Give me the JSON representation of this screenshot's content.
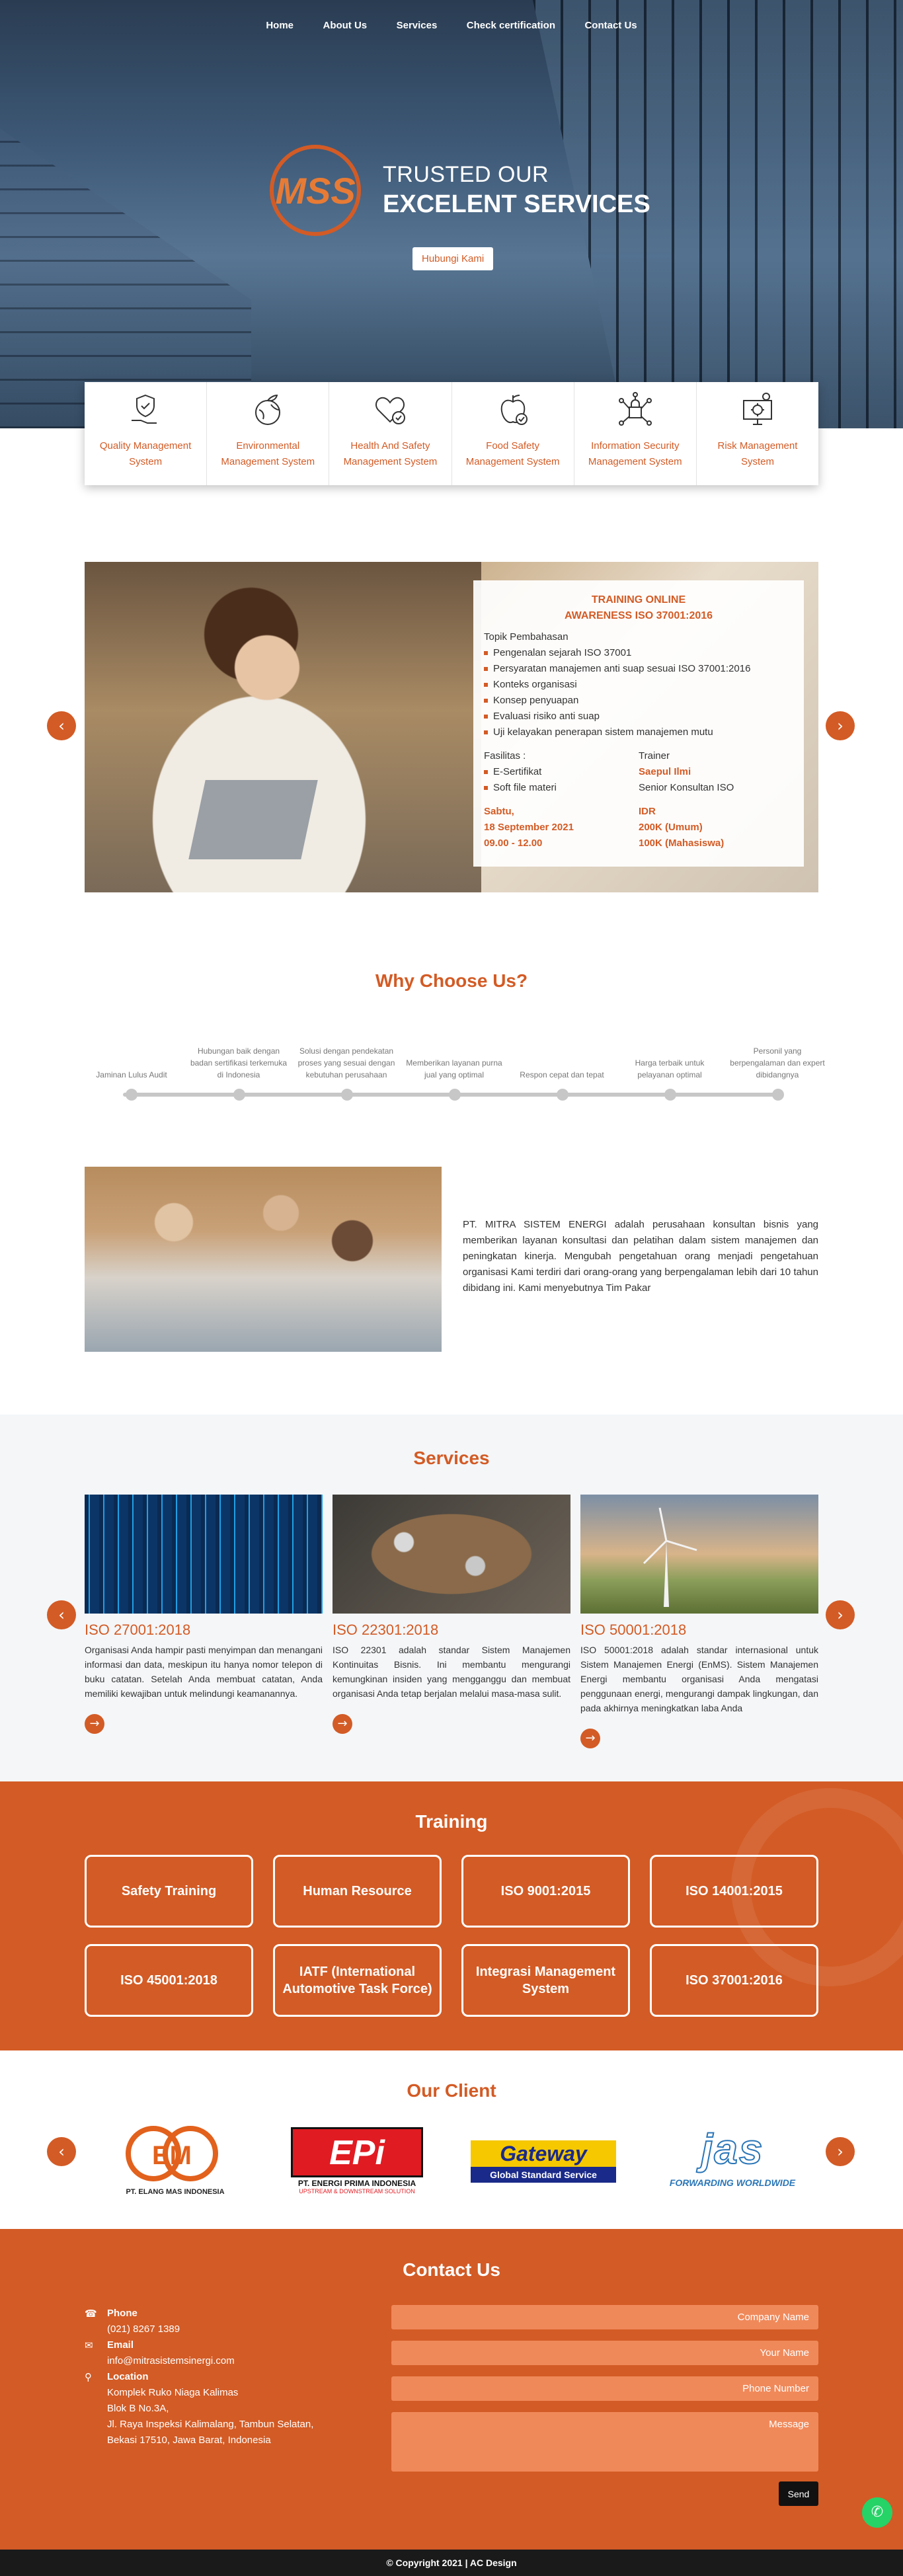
{
  "nav": {
    "home": "Home",
    "about": "About Us",
    "services": "Services",
    "check": "Check certification",
    "contact": "Contact Us"
  },
  "hero": {
    "logo_text": "MSS",
    "line1": "TRUSTED OUR",
    "line2": "EXCELENT SERVICES",
    "button": "Hubungi Kami"
  },
  "systems": [
    {
      "label": "Quality Management System",
      "icon": "hand-shield-icon"
    },
    {
      "label": "Environmental Management System",
      "icon": "globe-leaf-icon"
    },
    {
      "label": "Health And Safety Management System",
      "icon": "heart-check-icon"
    },
    {
      "label": "Food Safety Management System",
      "icon": "apple-check-icon"
    },
    {
      "label": "Information Security Management System",
      "icon": "lock-network-icon"
    },
    {
      "label": "Risk Management System",
      "icon": "gear-monitor-icon"
    }
  ],
  "training_banner": {
    "title1": "TRAINING ONLINE",
    "title2": "AWARENESS ISO 37001:2016",
    "topics_label": "Topik Pembahasan",
    "topics": [
      "Pengenalan sejarah ISO 37001",
      "Persyaratan manajemen anti suap sesuai ISO 37001:2016",
      "Konteks organisasi",
      "Konsep penyuapan",
      "Evaluasi risiko anti suap",
      "Uji kelayakan penerapan sistem manajemen mutu"
    ],
    "facilities_label": "Fasilitas :",
    "facilities": [
      "E-Sertifikat",
      "Soft file materi"
    ],
    "trainer_label": "Trainer",
    "trainer_name": "Saepul Ilmi",
    "trainer_role": "Senior Konsultan ISO",
    "day": "Sabtu,",
    "date": "18 September 2021",
    "time": "09.00 - 12.00",
    "currency": "IDR",
    "price_general": "200K (Umum)",
    "price_student": "100K (Mahasiswa)"
  },
  "why": {
    "title": "Why Choose Us?",
    "items": [
      "Jaminan Lulus Audit",
      "Hubungan baik dengan badan sertifikasi terkemuka di Indonesia",
      "Solusi dengan pendekatan proses yang sesuai dengan kebutuhan perusahaan",
      "Memberikan layanan purna jual yang optimal",
      "Respon cepat dan tepat",
      "Harga terbaik untuk pelayanan optimal",
      "Personil yang berpengalaman dan expert dibidangnya"
    ]
  },
  "about": {
    "text": "PT. MITRA SISTEM ENERGI adalah perusahaan konsultan bisnis yang memberikan layanan konsultasi dan pelatihan dalam sistem manajemen dan peningkatan kinerja. Mengubah pengetahuan orang menjadi pengetahuan organisasi Kami terdiri dari orang-orang yang berpengalaman lebih dari 10 tahun dibidang ini. Kami menyebutnya Tim Pakar"
  },
  "services": {
    "title": "Services",
    "items": [
      {
        "title": "ISO 27001:2018",
        "text": "Organisasi Anda hampir pasti menyimpan dan menangani informasi dan data, meskipun itu hanya nomor telepon di buku catatan. Setelah Anda membuat catatan, Anda memiliki kewajiban untuk melindungi keamanannya."
      },
      {
        "title": "ISO 22301:2018",
        "text": "ISO 22301 adalah standar Sistem Manajemen Kontinuitas Bisnis. Ini membantu mengurangi kemungkinan insiden yang mengganggu dan membuat organisasi Anda tetap berjalan melalui masa-masa sulit."
      },
      {
        "title": "ISO 50001:2018",
        "text": "ISO 50001:2018 adalah standar internasional untuk Sistem Manajemen Energi (EnMS). Sistem Manajemen Energi membantu organisasi Anda mengatasi penggunaan energi, mengurangi dampak lingkungan, dan pada akhirnya meningkatkan laba Anda"
      }
    ]
  },
  "training": {
    "title": "Training",
    "items": [
      "Safety Training",
      "Human Resource",
      "ISO 9001:2015",
      "ISO 14001:2015",
      "ISO 45001:2018",
      "IATF (International Automotive Task Force)",
      "Integrasi Management System",
      "ISO 37001:2016"
    ]
  },
  "clients": {
    "title": "Our Client",
    "items": [
      {
        "logo": "EM",
        "name": "PT. ELANG MAS INDONESIA"
      },
      {
        "logo": "EPi",
        "name": "PT. ENERGI PRIMA INDONESIA",
        "sub": "UPSTREAM & DOWNSTREAM SOLUTION"
      },
      {
        "logo": "Gateway",
        "name": "Global Standard Service"
      },
      {
        "logo": "jas",
        "name": "FORWARDING WORLDWIDE"
      }
    ]
  },
  "contact": {
    "title": "Contact Us",
    "phone_label": "Phone",
    "phone": "(021) 8267 1389",
    "email_label": "Email",
    "email": "info@mitrasistemsinergi.com",
    "location_label": "Location",
    "address1": "Komplek Ruko Niaga Kalimas",
    "address2": "Blok B No.3A,",
    "address3": "Jl. Raya Inspeksi Kalimalang, Tambun Selatan,",
    "address4": "Bekasi 17510, Jawa Barat, Indonesia",
    "company_ph": "Company Name",
    "name_ph": "Your Name",
    "phone_ph": "Phone Number",
    "message_ph": "Message",
    "send": "Send"
  },
  "footer": {
    "text": "© Copyright 2021 | AC Design"
  },
  "colors": {
    "accent": "#d35b25",
    "dark": "#1a1a1a"
  }
}
